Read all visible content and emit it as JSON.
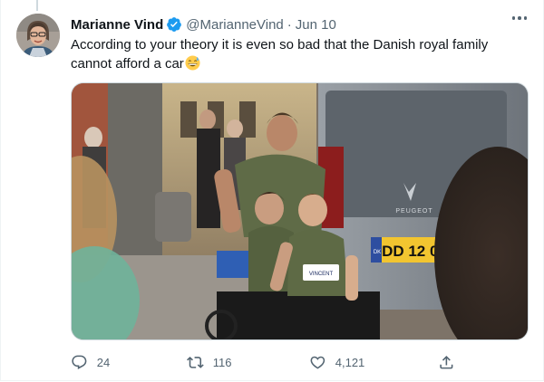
{
  "tweet": {
    "author_name": "Marianne Vind",
    "handle": "@MarianneVind",
    "separator": "·",
    "date": "Jun 10",
    "text": "According to your theory it is even so bad that the Danish royal family cannot afford a car",
    "emoji": "grinning-sweat-emoji",
    "media_plate_text": "DD 12 04",
    "media_plate_country": "DK",
    "media_brand_text": "PEUGEOT",
    "media_bib_text": "VINCENT"
  },
  "actions": {
    "replies": "24",
    "retweets": "116",
    "likes": "4,121"
  },
  "colors": {
    "accent": "#1d9bf0",
    "secondary_text": "#536471",
    "primary_text": "#0f1419"
  },
  "icons": [
    "verified-badge-icon",
    "more-options-icon",
    "reply-icon",
    "retweet-icon",
    "like-icon",
    "share-icon"
  ]
}
